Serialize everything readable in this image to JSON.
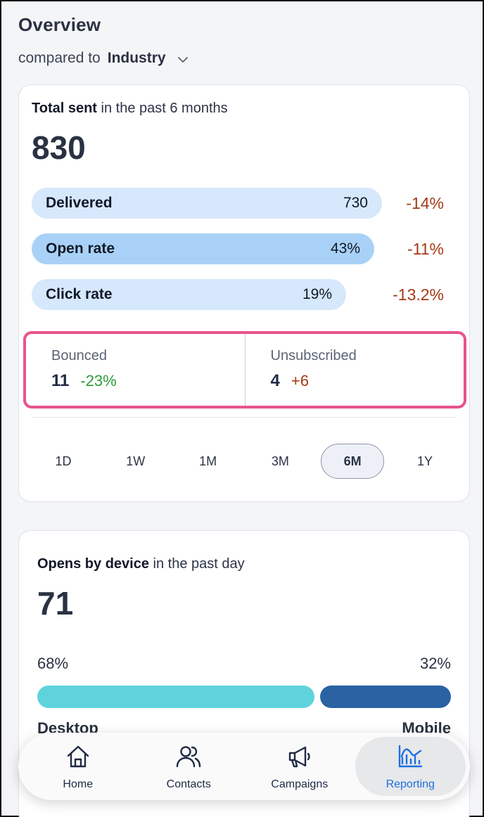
{
  "header": {
    "title": "Overview",
    "compare_prefix": "compared to",
    "compare_value": "Industry"
  },
  "total_sent": {
    "title_bold": "Total sent",
    "title_rest": " in the past 6 months",
    "value": "830",
    "metrics": [
      {
        "label": "Delivered",
        "value": "730",
        "delta": "-14%",
        "fill": 0.88,
        "color": "#d6e8fb"
      },
      {
        "label": "Open rate",
        "value": "43%",
        "delta": "-11%",
        "fill": 0.86,
        "color": "#a9d1f7"
      },
      {
        "label": "Click rate",
        "value": "19%",
        "delta": "-13.2%",
        "fill": 0.79,
        "color": "#d6e8fb"
      }
    ],
    "bounced": {
      "label": "Bounced",
      "value": "11",
      "delta": "-23%",
      "delta_color": "#2f9a3a"
    },
    "unsubscribed": {
      "label": "Unsubscribed",
      "value": "4",
      "delta": "+6",
      "delta_color": "#a33a16"
    },
    "ranges": [
      "1D",
      "1W",
      "1M",
      "3M",
      "6M",
      "1Y"
    ],
    "active_range": "6M"
  },
  "devices": {
    "title_bold": "Opens by device",
    "title_rest": " in the past day",
    "value": "71",
    "desktop_pct": "68%",
    "mobile_pct": "32%",
    "desktop_label": "Desktop",
    "mobile_label": "Mobile",
    "desktop_share": 0.68,
    "desktop_color": "#5fd3dc",
    "mobile_color": "#2a62a3"
  },
  "tabs": [
    {
      "label": "Home",
      "icon": "home-icon"
    },
    {
      "label": "Contacts",
      "icon": "contacts-icon"
    },
    {
      "label": "Campaigns",
      "icon": "megaphone-icon"
    },
    {
      "label": "Reporting",
      "icon": "reporting-chart-icon",
      "active": true
    }
  ]
}
